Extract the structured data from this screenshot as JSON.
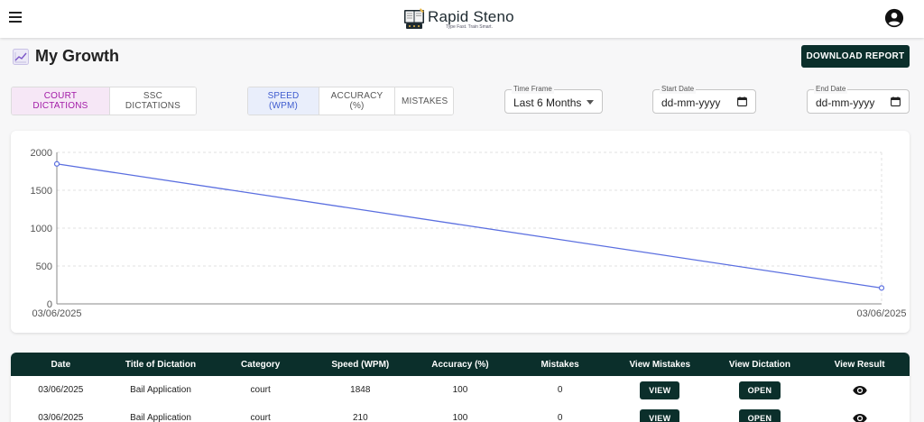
{
  "header": {
    "brand": "Rapid Steno",
    "tagline": "Type Fast. Train Smart.",
    "menu_icon": "hamburger-menu-icon",
    "account_icon": "account-circle-icon"
  },
  "page": {
    "title": "My Growth",
    "title_icon": "chart-line-icon",
    "download_label": "DOWNLOAD REPORT"
  },
  "dictation_tabs": [
    {
      "label": "COURT DICTATIONS",
      "active": true
    },
    {
      "label": "SSC DICTATIONS",
      "active": false
    }
  ],
  "metric_tabs": [
    {
      "label": "SPEED (WPM)",
      "active": true
    },
    {
      "label": "ACCURACY (%)",
      "active": false
    },
    {
      "label": "MISTAKES",
      "active": false
    }
  ],
  "filters": {
    "time_frame_label": "Time Frame",
    "time_frame_value": "Last 6 Months",
    "start_date_label": "Start Date",
    "start_date_value": "dd-mm-yyyy",
    "end_date_label": "End Date",
    "end_date_value": "dd-mm-yyyy"
  },
  "chart_data": {
    "type": "line",
    "x": [
      "03/06/2025",
      "03/06/2025"
    ],
    "series": [
      {
        "values": [
          1848,
          210
        ],
        "color": "#5b6fe0"
      }
    ],
    "title": "",
    "xlabel": "",
    "ylabel": "",
    "ylim": [
      0,
      2000
    ],
    "yticks": [
      0,
      500,
      1000,
      1500,
      2000
    ],
    "grid": true
  },
  "table": {
    "columns": [
      "Date",
      "Title of Dictation",
      "Category",
      "Speed (WPM)",
      "Accuracy (%)",
      "Mistakes",
      "View Mistakes",
      "View Dictation",
      "View Result"
    ],
    "view_label": "VIEW",
    "open_label": "OPEN",
    "result_icon": "eye-icon",
    "rows": [
      {
        "date": "03/06/2025",
        "title": "Bail Application",
        "category": "court",
        "speed": "1848",
        "accuracy": "100",
        "mistakes": "0"
      },
      {
        "date": "03/06/2025",
        "title": "Bail Application",
        "category": "court",
        "speed": "210",
        "accuracy": "100",
        "mistakes": "0"
      }
    ]
  },
  "colors": {
    "primary_dark": "#0b2f2b",
    "court_tab_active": "#a21ba7",
    "speed_tab_active": "#3f5ccf",
    "line": "#5b6fe0"
  }
}
